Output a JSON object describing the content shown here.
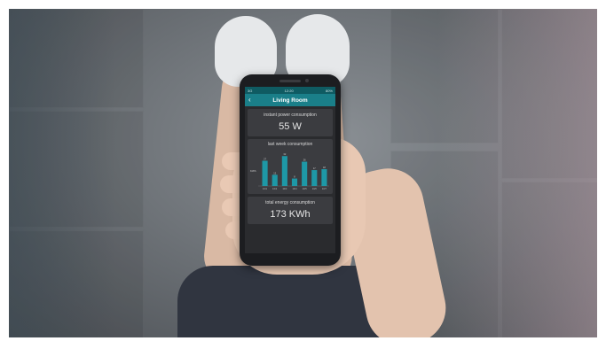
{
  "status_bar": {
    "left": "3G",
    "center": "12:20",
    "right": "80%"
  },
  "app_bar": {
    "back_icon": "chevron-left-icon",
    "title": "Living Room"
  },
  "instant_power": {
    "label": "instant power consumption",
    "value": "55 W"
  },
  "weekly": {
    "label": "last week consumption",
    "y_label": "KWh",
    "chart_data": {
      "type": "bar",
      "title": "last week consumption",
      "ylabel": "KWh",
      "categories": [
        "10/1",
        "10/2",
        "10/3",
        "10/4",
        "10/5",
        "10/6",
        "10/7"
      ],
      "values": [
        27,
        12,
        32,
        8,
        26,
        17,
        18
      ],
      "ylim": [
        0,
        36
      ],
      "grid": false,
      "color": "#1e98a6"
    }
  },
  "total_energy": {
    "label": "total energy consumption",
    "value": "173 KWh"
  },
  "colors": {
    "accent": "#1a7f89",
    "status_bar": "#0f5b62",
    "card": "#3b3c40",
    "bar": "#1e98a6"
  }
}
